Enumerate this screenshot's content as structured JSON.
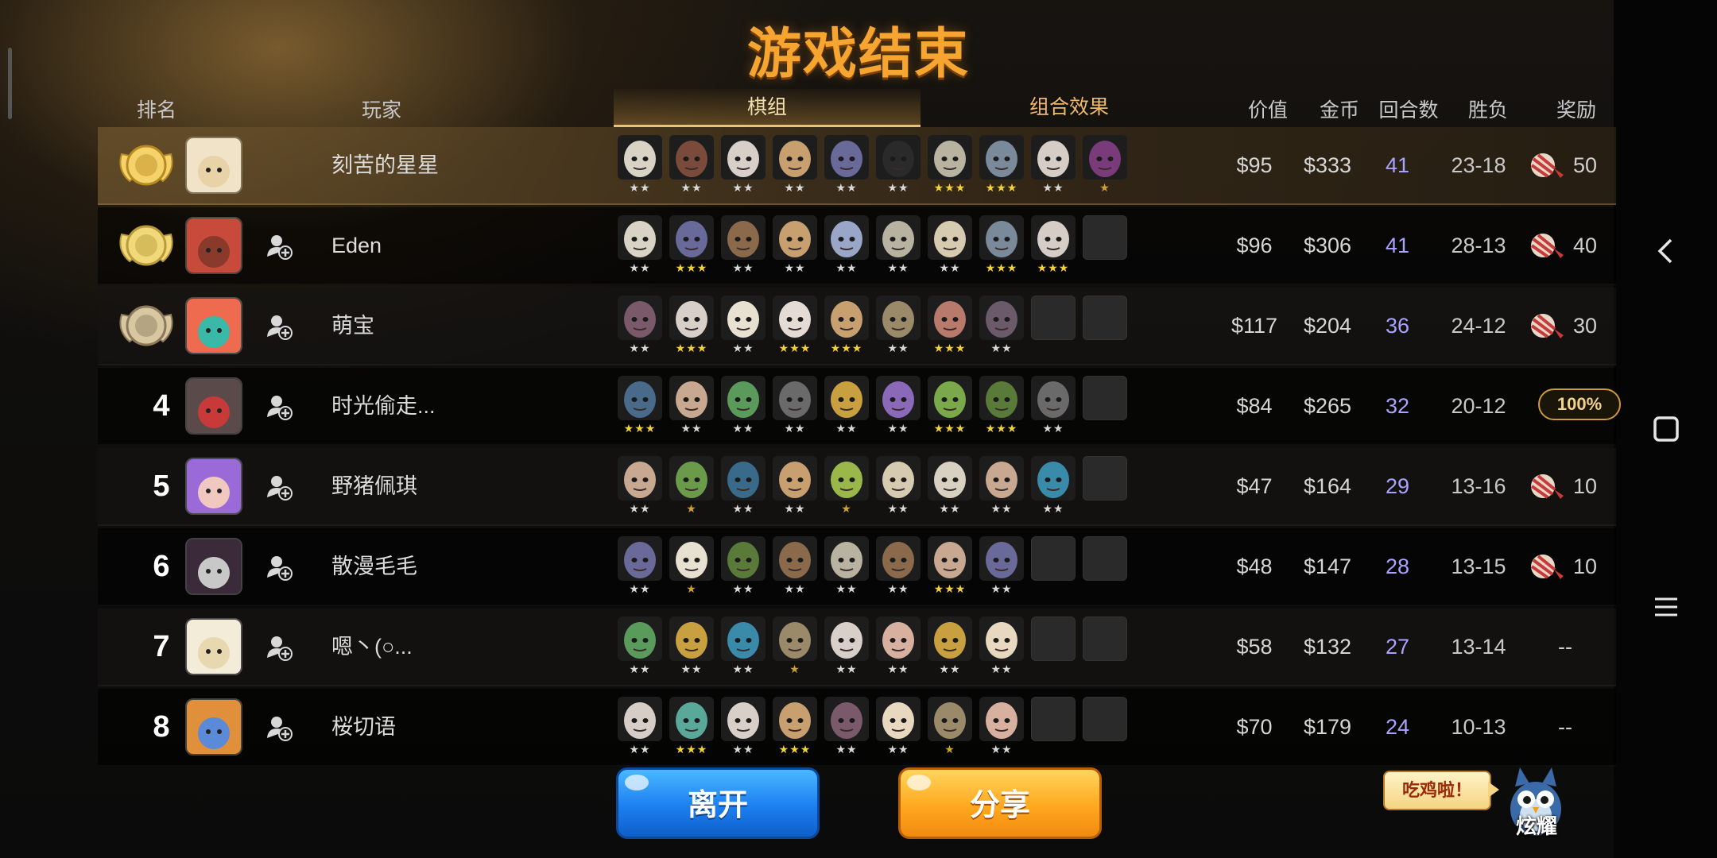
{
  "title": "游戏结束",
  "headers": {
    "rank": "排名",
    "player": "玩家",
    "tab_lineup": "棋组",
    "tab_combo": "组合效果",
    "value": "价值",
    "gold": "金币",
    "rounds": "回合数",
    "win_loss": "胜负",
    "reward": "奖励"
  },
  "colors": {
    "accent_orange": "#f7a531",
    "rounds_purple": "#a9a3ff",
    "star_gold": "#f2d23a"
  },
  "rows": [
    {
      "rank": "",
      "medal": "gold-medal",
      "name": "刻苦的星星",
      "value": "$95",
      "gold": "$333",
      "rounds": "41",
      "wl": "23-18",
      "reward": "50",
      "reward_type": "candy",
      "pieces": [
        [
          2,
          "#d9d3c6"
        ],
        [
          2,
          "#7a4a3a"
        ],
        [
          2,
          "#d8d0c8"
        ],
        [
          2,
          "#c8a070"
        ],
        [
          2,
          "#6a6a9a"
        ],
        [
          2,
          "#2a2a2a"
        ],
        [
          3,
          "#b8b2a0"
        ],
        [
          3,
          "#7a8a9a"
        ],
        [
          2,
          "#d6cdc6"
        ],
        [
          1,
          "#7a3b7a"
        ]
      ]
    },
    {
      "rank": "",
      "medal": "silver-medal",
      "name": "Eden",
      "value": "$96",
      "gold": "$306",
      "rounds": "41",
      "wl": "28-13",
      "reward": "40",
      "reward_type": "candy",
      "pieces": [
        [
          2,
          "#d9d3c6"
        ],
        [
          3,
          "#6a6a9a"
        ],
        [
          2,
          "#8a6a4a"
        ],
        [
          2,
          "#c8a070"
        ],
        [
          2,
          "#9aa6c8"
        ],
        [
          2,
          "#b8b2a0"
        ],
        [
          2,
          "#d6cab0"
        ],
        [
          3,
          "#7a8a9a"
        ],
        [
          3,
          "#d6cdc6"
        ],
        [
          0,
          ""
        ]
      ]
    },
    {
      "rank": "",
      "medal": "bronze-medal",
      "name": "萌宝",
      "value": "$117",
      "gold": "$204",
      "rounds": "36",
      "wl": "24-12",
      "reward": "30",
      "reward_type": "candy",
      "pieces": [
        [
          2,
          "#7a5a6a"
        ],
        [
          3,
          "#d8d0c8"
        ],
        [
          2,
          "#e8e0d0"
        ],
        [
          3,
          "#e4dcd4"
        ],
        [
          3,
          "#c8a070"
        ],
        [
          2,
          "#9a8a6a"
        ],
        [
          3,
          "#b87a6a"
        ],
        [
          2,
          "#6a5a6a"
        ],
        [
          0,
          ""
        ],
        [
          0,
          ""
        ]
      ]
    },
    {
      "rank": "4",
      "medal": "",
      "name": "时光偷走...",
      "value": "$84",
      "gold": "$265",
      "rounds": "32",
      "wl": "20-12",
      "reward": "100%",
      "reward_type": "badge",
      "pieces": [
        [
          3,
          "#4a6a8a"
        ],
        [
          2,
          "#c8a890"
        ],
        [
          2,
          "#5a9a5a"
        ],
        [
          2,
          "#6a6a6a"
        ],
        [
          2,
          "#c8a040"
        ],
        [
          2,
          "#8a6ab8"
        ],
        [
          3,
          "#7aa84a"
        ],
        [
          3,
          "#5a7a3a"
        ],
        [
          2,
          "#6a6a6a"
        ],
        [
          0,
          ""
        ]
      ]
    },
    {
      "rank": "5",
      "medal": "",
      "name": "野猪佩琪",
      "value": "$47",
      "gold": "$164",
      "rounds": "29",
      "wl": "13-16",
      "reward": "10",
      "reward_type": "candy",
      "pieces": [
        [
          2,
          "#c8a890"
        ],
        [
          1,
          "#6a9a4a"
        ],
        [
          2,
          "#3a6a8a"
        ],
        [
          2,
          "#c8a070"
        ],
        [
          1,
          "#9ab84a"
        ],
        [
          2,
          "#d6cab0"
        ],
        [
          2,
          "#d8d0c0"
        ],
        [
          2,
          "#c8a890"
        ],
        [
          2,
          "#3a8aaa"
        ],
        [
          0,
          ""
        ]
      ]
    },
    {
      "rank": "6",
      "medal": "",
      "name": "散漫毛毛",
      "value": "$48",
      "gold": "$147",
      "rounds": "28",
      "wl": "13-15",
      "reward": "10",
      "reward_type": "candy",
      "pieces": [
        [
          2,
          "#6a6a9a"
        ],
        [
          1,
          "#e8e0d0"
        ],
        [
          2,
          "#5a7a3a"
        ],
        [
          2,
          "#8a6a4a"
        ],
        [
          2,
          "#b8b2a0"
        ],
        [
          2,
          "#8a6a4a"
        ],
        [
          3,
          "#c8a890"
        ],
        [
          2,
          "#6a6a9a"
        ],
        [
          0,
          ""
        ],
        [
          0,
          ""
        ]
      ]
    },
    {
      "rank": "7",
      "medal": "",
      "name": "嗯丶(○...",
      "value": "$58",
      "gold": "$132",
      "rounds": "27",
      "wl": "13-14",
      "reward": "--",
      "reward_type": "none",
      "pieces": [
        [
          2,
          "#5a9a5a"
        ],
        [
          2,
          "#c8a040"
        ],
        [
          2,
          "#3a8aaa"
        ],
        [
          1,
          "#9a8a6a"
        ],
        [
          2,
          "#d8d0c8"
        ],
        [
          2,
          "#d8b0a0"
        ],
        [
          2,
          "#c8a040"
        ],
        [
          2,
          "#e8d8c0"
        ],
        [
          0,
          ""
        ],
        [
          0,
          ""
        ]
      ]
    },
    {
      "rank": "8",
      "medal": "",
      "name": "桜切语",
      "value": "$70",
      "gold": "$179",
      "rounds": "24",
      "wl": "10-13",
      "reward": "--",
      "reward_type": "none",
      "pieces": [
        [
          2,
          "#d6cdc6"
        ],
        [
          3,
          "#5aa89a"
        ],
        [
          2,
          "#d8d0c8"
        ],
        [
          3,
          "#c8a070"
        ],
        [
          2,
          "#7a5a6a"
        ],
        [
          2,
          "#e8d8c0"
        ],
        [
          1,
          "#9a8a6a"
        ],
        [
          2,
          "#d8b0a0"
        ],
        [
          0,
          ""
        ],
        [
          0,
          ""
        ]
      ]
    }
  ],
  "buttons": {
    "leave": "离开",
    "share": "分享"
  },
  "bubble": "吃鸡啦！",
  "flaunt": "炫耀"
}
